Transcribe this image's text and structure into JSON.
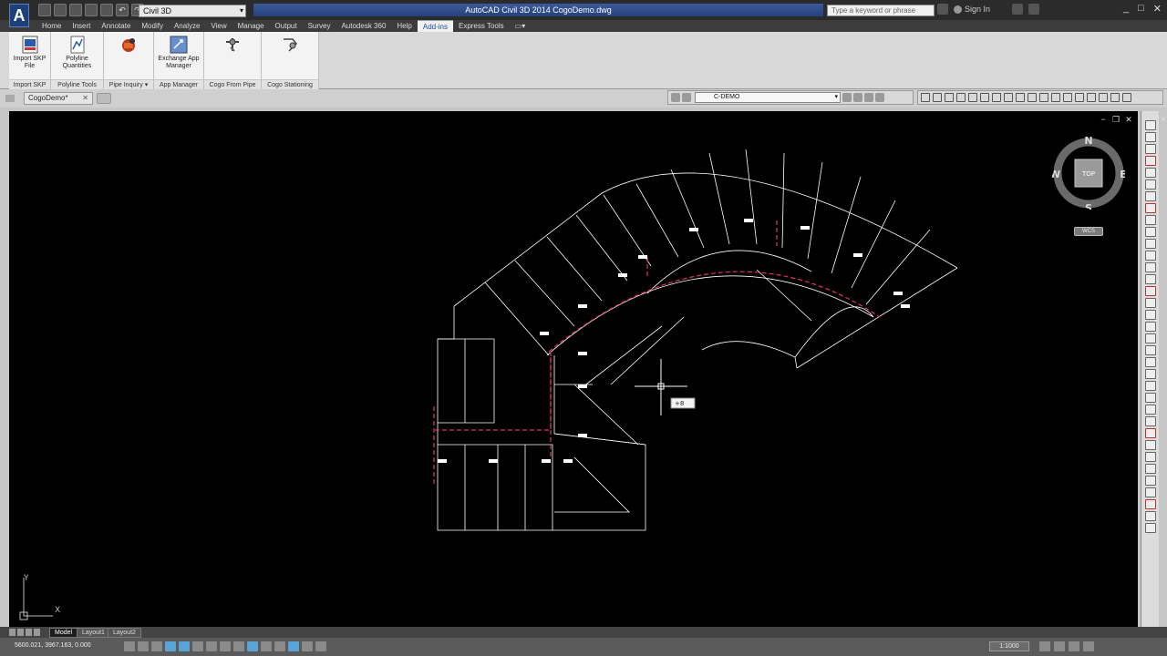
{
  "app": {
    "logo": "A",
    "title": "AutoCAD Civil 3D 2014    CogoDemo.dwg",
    "workspace": "Civil 3D",
    "search_placeholder": "Type a keyword or phrase",
    "signin": "Sign In",
    "win_controls": [
      "_",
      "□",
      "✕"
    ]
  },
  "ribbon": {
    "tabs": [
      "Home",
      "Insert",
      "Annotate",
      "Modify",
      "Analyze",
      "View",
      "Manage",
      "Output",
      "Survey",
      "Autodesk 360",
      "Help",
      "Add-ins",
      "Express Tools"
    ],
    "active_tab": "Add-ins",
    "panels": [
      {
        "button": "Import SKP File",
        "title": "Import SKP",
        "icon": "import-skp-icon"
      },
      {
        "button": "Polyline Quantities",
        "title": "Polyline Tools",
        "icon": "polyline-quantities-icon"
      },
      {
        "button": "",
        "title": "Pipe Inquiry ▾",
        "icon": "pipe-inquiry-icon"
      },
      {
        "button": "Exchange App Manager",
        "title": "App Manager",
        "icon": "app-manager-icon"
      },
      {
        "button": "",
        "title": "Cogo From Pipe",
        "icon": "cogo-from-pipe-icon"
      },
      {
        "button": "",
        "title": "Cogo Stationing",
        "icon": "cogo-stationing-icon"
      }
    ]
  },
  "file_tabs": {
    "active": "CogoDemo*",
    "close": "✕"
  },
  "layer_toolbar": {
    "current_layer": "C-DEMO"
  },
  "viewcube": {
    "top": "TOP",
    "north": "N",
    "south": "S",
    "east": "E",
    "west": "W",
    "wcs": "WCS"
  },
  "cursor_tooltip": "+8",
  "ucs": {
    "x": "X",
    "y": "Y"
  },
  "layout_tabs": [
    "Model",
    "Layout1",
    "Layout2"
  ],
  "statusbar": {
    "coords": "5600.021, 3967.163, 0.000",
    "scale": "1:1000"
  },
  "colors": {
    "pipe": "#e0336e",
    "linework": "#ffffff",
    "title_strip": "#2d4d8c"
  }
}
